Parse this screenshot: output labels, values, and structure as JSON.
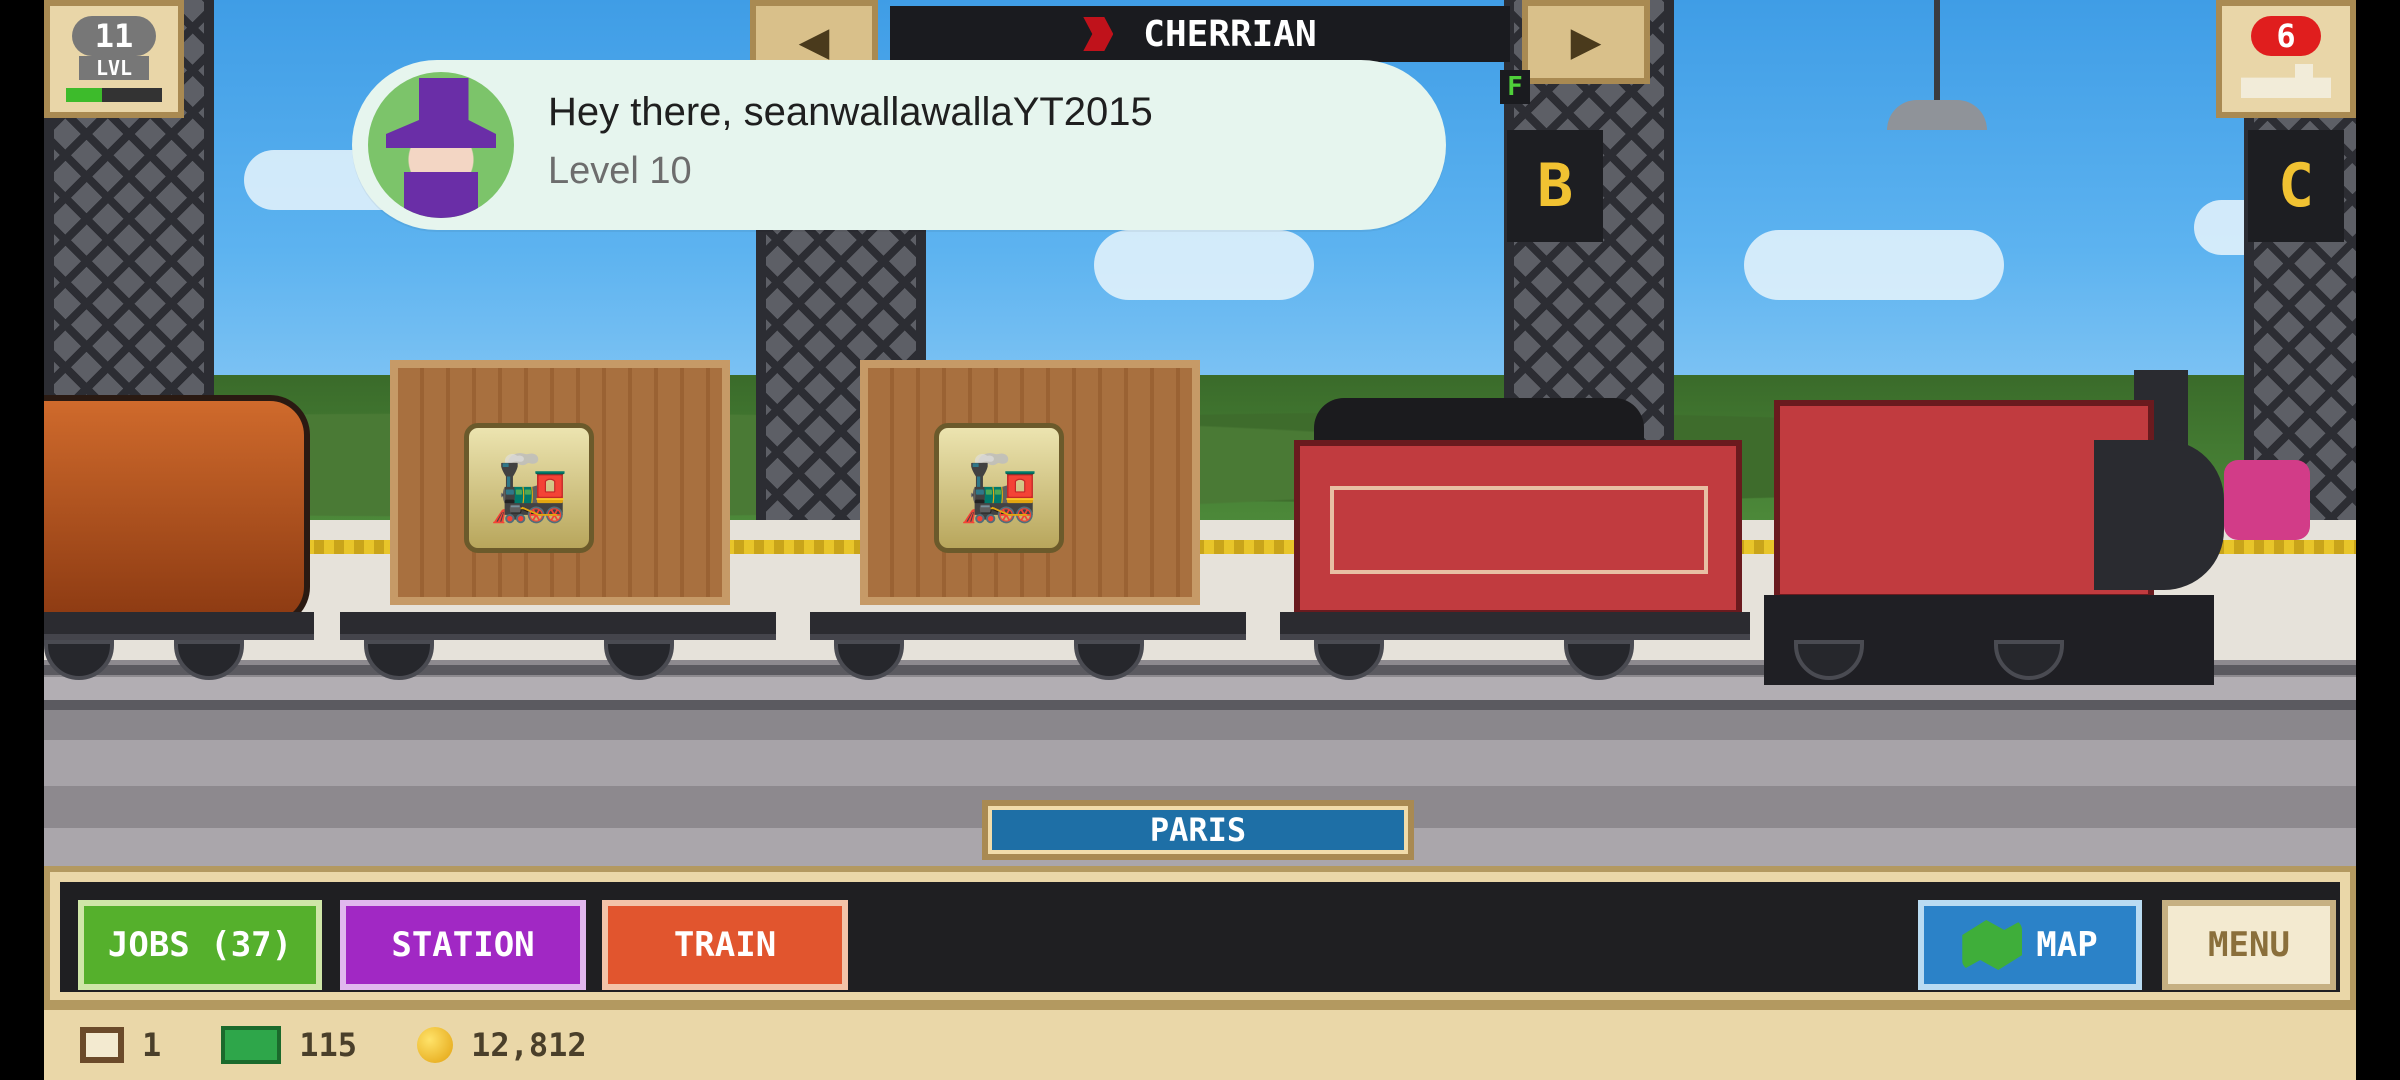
{
  "hud": {
    "level": {
      "value": "11",
      "label": "LVL",
      "progress": 0.38
    },
    "train_name": "CHERRIAN",
    "fuel_indicator": "F",
    "cargo_badge": "6",
    "platform_signs": [
      "B",
      "C"
    ]
  },
  "notification": {
    "title": "Hey there, seanwallawallaYT2015",
    "subtitle": "Level 10"
  },
  "station": {
    "name": "PARIS"
  },
  "buttons": {
    "jobs": "JOBS (37)",
    "station": "STATION",
    "train": "TRAIN",
    "map": "MAP",
    "menu": "MENU"
  },
  "status": {
    "cargo_count": "1",
    "cash": "115",
    "coins": "12,812"
  },
  "colors": {
    "jobs": "#55b02c",
    "station": "#a128c4",
    "train": "#e1552e",
    "map": "#2b82c8",
    "locomotive": "#c13b3f"
  },
  "icons": [
    "left-arrow-icon",
    "right-arrow-icon",
    "flag-icon",
    "map-icon",
    "cargo-icon",
    "cash-icon",
    "coin-icon",
    "train-icon"
  ]
}
